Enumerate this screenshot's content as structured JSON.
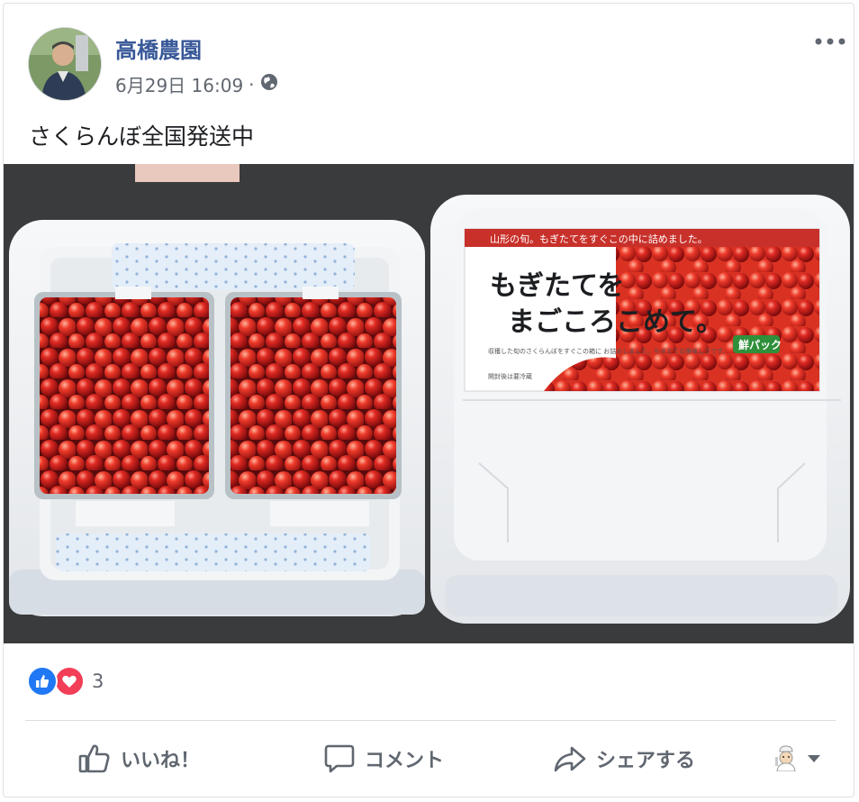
{
  "post": {
    "page_name": "高橋農園",
    "timestamp": "6月29日 16:09",
    "separator": "·",
    "privacy_icon": "globe-icon",
    "text": "さくらんぼ全国発送中"
  },
  "photo": {
    "lid_banner_small": "山形の旬。もぎたてをすぐこの中に詰めました。",
    "lid_headline_1": "もぎたてを",
    "lid_headline_2": "まごころこめて。",
    "lid_badge": "鮮パック",
    "lid_desc": "収穫した旬のさくらんぼをすぐこの箱に お詰めしました。もぎたての美味しさです。",
    "lid_origin": "開封後は要冷蔵"
  },
  "reactions": {
    "icons": [
      "like-icon",
      "love-icon"
    ],
    "count": "3"
  },
  "actions": {
    "like_label": "いいね！",
    "comment_label": "コメント",
    "share_label": "シェアする"
  },
  "colors": {
    "page_name": "#385898",
    "meta": "#616770",
    "like_blue": "#2078f4",
    "love_red": "#f33e58"
  }
}
